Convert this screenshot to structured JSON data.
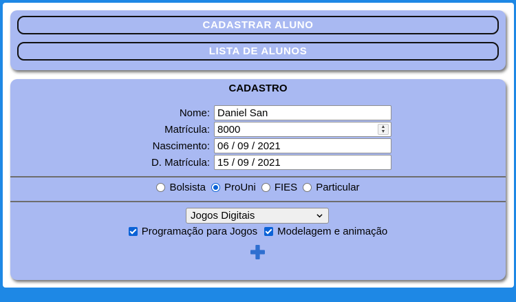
{
  "nav": {
    "register_label": "CADASTRAR ALUNO",
    "list_label": "LISTA DE ALUNOS"
  },
  "form": {
    "title": "CADASTRO",
    "fields": {
      "nome": {
        "label": "Nome:",
        "value": "Daniel San"
      },
      "matricula": {
        "label": "Matrícula:",
        "value": "8000"
      },
      "nascimento": {
        "label": "Nascimento:",
        "value": "06 / 09 / 2021"
      },
      "d_matricula": {
        "label": "D. Matrícula:",
        "value": "15 / 09 / 2021"
      }
    },
    "radio_options": [
      {
        "label": "Bolsista",
        "selected": false
      },
      {
        "label": "ProUni",
        "selected": true
      },
      {
        "label": "FIES",
        "selected": false
      },
      {
        "label": "Particular",
        "selected": false
      }
    ],
    "course_select": {
      "value": "Jogos Digitais"
    },
    "checkboxes": [
      {
        "label": "Programação para Jogos",
        "checked": true
      },
      {
        "label": "Modelagem e animação",
        "checked": true
      }
    ],
    "add_icon": "plus-icon"
  },
  "colors": {
    "background": "#1e88e5",
    "card": "#a9b9f2",
    "accent": "#0b62d6",
    "add_icon": "#2f6fd0"
  }
}
